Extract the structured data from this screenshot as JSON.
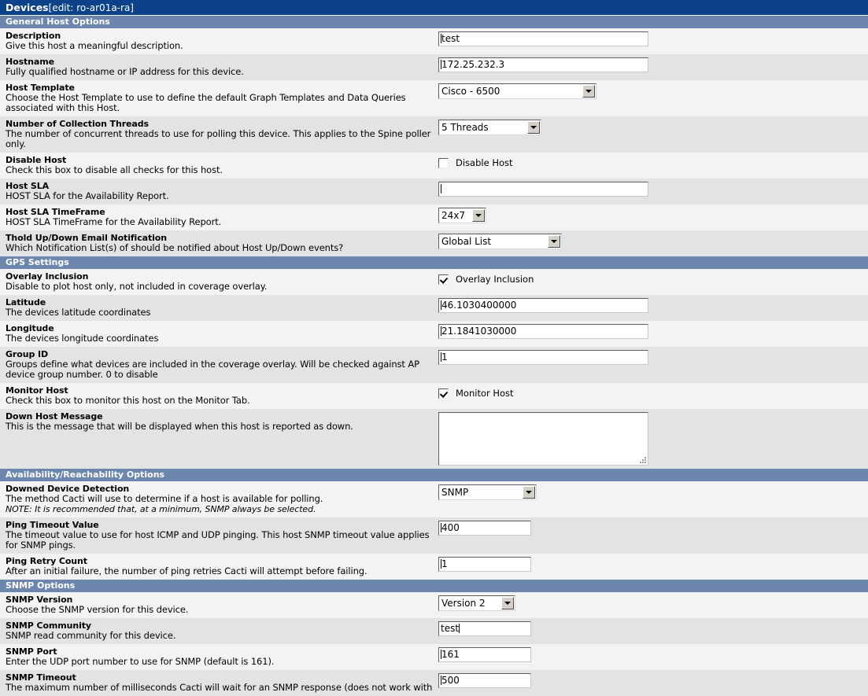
{
  "titlebar": {
    "title": "Devices",
    "subtitle": "[edit: ro-ar01a-ra]"
  },
  "sections": [
    {
      "header": "General Host Options",
      "rows": [
        {
          "name": "Description",
          "desc": "Give this host a meaningful description.",
          "note": "",
          "widget": "text-wide",
          "value": "test"
        },
        {
          "name": "Hostname",
          "desc": "Fully qualified hostname or IP address for this device.",
          "note": "",
          "widget": "text-wide",
          "value": "172.25.232.3"
        },
        {
          "name": "Host Template",
          "desc": "Choose the Host Template to use to define the default Graph Templates and Data Queries associated with this Host.",
          "note": "",
          "widget": "select-template",
          "value": "Cisco - 6500"
        },
        {
          "name": "Number of Collection Threads",
          "desc": "The number of concurrent threads to use for polling this device. This applies to the Spine poller only.",
          "note": "",
          "widget": "select-threads",
          "value": "5 Threads"
        },
        {
          "name": "Disable Host",
          "desc": "Check this box to disable all checks for this host.",
          "note": "",
          "widget": "checkbox",
          "value": "Disable Host",
          "checked": false
        },
        {
          "name": "Host SLA",
          "desc": "HOST SLA for the Availability Report.",
          "note": "",
          "widget": "text-wide",
          "value": ""
        },
        {
          "name": "Host SLA TimeFrame",
          "desc": "HOST SLA TimeFrame for the Availability Report.",
          "note": "",
          "widget": "select-sla",
          "value": "24x7"
        },
        {
          "name": "Thold Up/Down Email Notification",
          "desc": "Which Notification List(s) of should be notified about Host Up/Down events?",
          "note": "",
          "widget": "select-thold",
          "value": "Global List"
        }
      ]
    },
    {
      "header": "GPS Settings",
      "rows": [
        {
          "name": "Overlay Inclusion",
          "desc": "Disable to plot host only, not included in coverage overlay.",
          "note": "",
          "widget": "checkbox",
          "value": "Overlay Inclusion",
          "checked": true
        },
        {
          "name": "Latitude",
          "desc": "The devices latitude coordinates",
          "note": "",
          "widget": "text-wide",
          "value": "46.1030400000"
        },
        {
          "name": "Longitude",
          "desc": "The devices longitude coordinates",
          "note": "",
          "widget": "text-wide",
          "value": "21.1841030000"
        },
        {
          "name": "Group ID",
          "desc": "Groups define what devices are included in the coverage overlay. Will be checked against AP device group number. 0 to disable",
          "note": "",
          "widget": "text-wide",
          "value": "1"
        },
        {
          "name": "Monitor Host",
          "desc": "Check this box to monitor this host on the Monitor Tab.",
          "note": "",
          "widget": "checkbox",
          "value": "Monitor Host",
          "checked": true
        },
        {
          "name": "Down Host Message",
          "desc": "This is the message that will be displayed when this host is reported as down.",
          "note": "",
          "widget": "textarea",
          "value": ""
        }
      ]
    },
    {
      "header": "Availability/Reachability Options",
      "rows": [
        {
          "name": "Downed Device Detection",
          "desc": "The method Cacti will use to determine if a host is available for polling.",
          "note": "NOTE: It is recommended that, at a minimum, SNMP always be selected.",
          "widget": "select-downed",
          "value": "SNMP"
        },
        {
          "name": "Ping Timeout Value",
          "desc": "The timeout value to use for host ICMP and UDP pinging. This host SNMP timeout value applies for SNMP pings.",
          "note": "",
          "widget": "text-narrow",
          "value": "400"
        },
        {
          "name": "Ping Retry Count",
          "desc": "After an initial failure, the number of ping retries Cacti will attempt before failing.",
          "note": "",
          "widget": "text-narrow",
          "value": "1"
        }
      ]
    },
    {
      "header": "SNMP Options",
      "rows": [
        {
          "name": "SNMP Version",
          "desc": "Choose the SNMP version for this device.",
          "note": "",
          "widget": "select-snmpver",
          "value": "Version 2"
        },
        {
          "name": "SNMP Community",
          "desc": "SNMP read community for this device.",
          "note": "",
          "widget": "text-narrow-focus",
          "value": "test"
        },
        {
          "name": "SNMP Port",
          "desc": "Enter the UDP port number to use for SNMP (default is 161).",
          "note": "",
          "widget": "text-narrow",
          "value": "161"
        },
        {
          "name": "SNMP Timeout",
          "desc": "The maximum number of milliseconds Cacti will wait for an SNMP response (does not work with",
          "note": "",
          "widget": "text-narrow",
          "value": "500"
        }
      ]
    }
  ],
  "colors": {
    "titlebar": "#0b4289",
    "section_header": "#6d86ad",
    "row_odd": "#f3f3f4",
    "row_even": "#e2e3e4"
  }
}
